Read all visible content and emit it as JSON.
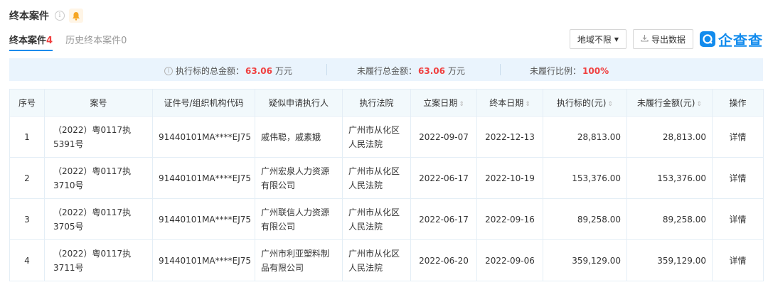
{
  "header": {
    "title": "终本案件"
  },
  "tabs": [
    {
      "label": "终本案件",
      "count": "4"
    },
    {
      "label": "历史终本案件",
      "count": "0"
    }
  ],
  "toolbar": {
    "region_label": "地域不限",
    "export_label": "导出数据",
    "brand_name": "企查查"
  },
  "summary": {
    "exec_label": "执行标的总金额：",
    "exec_value": "63.06",
    "exec_unit": "万元",
    "unfulfilled_label": "未履行总金额：",
    "unfulfilled_value": "63.06",
    "unfulfilled_unit": "万元",
    "ratio_label": "未履行比例：",
    "ratio_value": "100%"
  },
  "table": {
    "headers": [
      "序号",
      "案号",
      "证件号/组织机构代码",
      "疑似申请执行人",
      "执行法院",
      "立案日期",
      "终本日期",
      "执行标的(元)",
      "未履行金额(元)",
      "操作"
    ],
    "rows": [
      {
        "index": "1",
        "case_no": "（2022）粤0117执5391号",
        "id_code": "91440101MA****EJ75",
        "applicant": "戚伟聪，戚素娥",
        "applicant_link": false,
        "court": "广州市从化区人民法院",
        "filing_date": "2022-09-07",
        "end_date": "2022-12-13",
        "exec_amount": "28,813.00",
        "unfulfilled_amount": "28,813.00",
        "action": "详情"
      },
      {
        "index": "2",
        "case_no": "（2022）粤0117执3710号",
        "id_code": "91440101MA****EJ75",
        "applicant": "广州宏泉人力资源有限公司",
        "applicant_link": true,
        "court": "广州市从化区人民法院",
        "filing_date": "2022-06-17",
        "end_date": "2022-10-19",
        "exec_amount": "153,376.00",
        "unfulfilled_amount": "153,376.00",
        "action": "详情"
      },
      {
        "index": "3",
        "case_no": "（2022）粤0117执3705号",
        "id_code": "91440101MA****EJ75",
        "applicant": "广州联信人力资源有限公司",
        "applicant_link": true,
        "court": "广州市从化区人民法院",
        "filing_date": "2022-06-17",
        "end_date": "2022-09-16",
        "exec_amount": "89,258.00",
        "unfulfilled_amount": "89,258.00",
        "action": "详情"
      },
      {
        "index": "4",
        "case_no": "（2022）粤0117执3711号",
        "id_code": "91440101MA****EJ75",
        "applicant": "广州市利亚塑料制品有限公司",
        "applicant_link": true,
        "court": "广州市从化区人民法院",
        "filing_date": "2022-06-20",
        "end_date": "2022-09-06",
        "exec_amount": "359,129.00",
        "unfulfilled_amount": "359,129.00",
        "action": "详情"
      }
    ]
  },
  "colors": {
    "accent": "#128bed",
    "highlight": "#f04040",
    "summary_bg": "#eaf4fd",
    "header_bg": "#f2f9fc",
    "bell": "#f6a623"
  },
  "icons": {
    "info": "info-icon",
    "bell": "bell-icon",
    "caret": "caret-down-icon",
    "download": "download-icon",
    "brand": "qichacha-logo-icon"
  }
}
